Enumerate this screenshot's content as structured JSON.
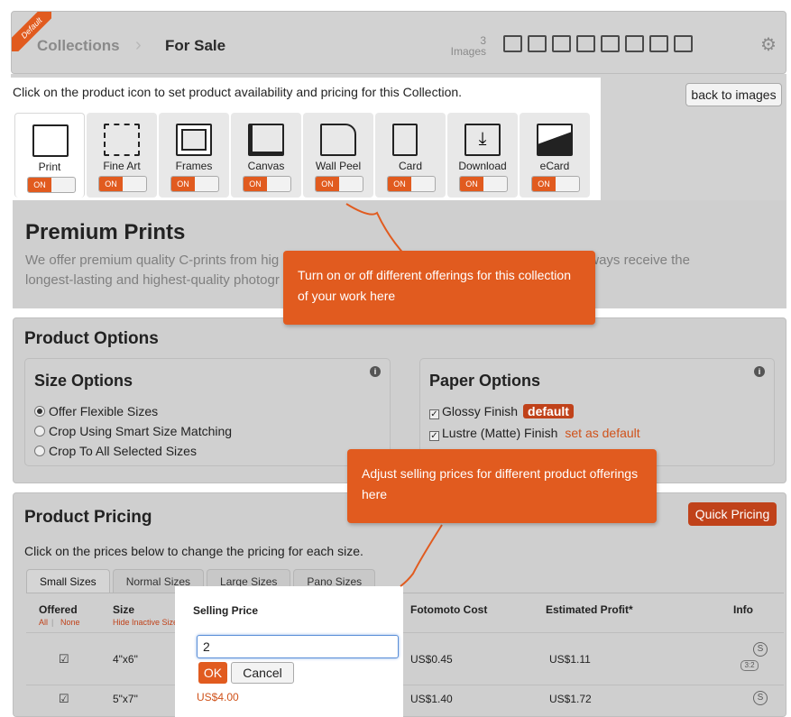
{
  "header": {
    "ribbon": "Default",
    "crumb_collections": "Collections",
    "crumb_separator": "›",
    "crumb_current": "For Sale",
    "image_count": "3",
    "image_count_label": "Images",
    "toolbar_icons": [
      "print-icon",
      "fine-art-icon",
      "frames-icon",
      "canvas-icon",
      "wall-peel-icon",
      "card-icon",
      "download-icon",
      "ecard-icon"
    ],
    "settings_icon": "gear-icon"
  },
  "products": {
    "intro": "Click on the product icon to set product availability and pricing for this Collection.",
    "back_button": "back to images",
    "items": [
      {
        "label": "Print",
        "toggle": "ON"
      },
      {
        "label": "Fine Art",
        "toggle": "ON"
      },
      {
        "label": "Frames",
        "toggle": "ON"
      },
      {
        "label": "Canvas",
        "toggle": "ON"
      },
      {
        "label": "Wall Peel",
        "toggle": "ON"
      },
      {
        "label": "Card",
        "toggle": "ON"
      },
      {
        "label": "Download",
        "toggle": "ON"
      },
      {
        "label": "eCard",
        "toggle": "ON"
      }
    ]
  },
  "premium": {
    "title": "Premium Prints",
    "line1_left": "We offer premium quality C-prints from hig",
    "line1_right": "you always receive the",
    "line2": "longest-lasting and highest-quality photogr"
  },
  "options": {
    "title": "Product Options",
    "size": {
      "title": "Size Options",
      "items": [
        "Offer Flexible Sizes",
        "Crop Using Smart Size Matching",
        "Crop To All Selected Sizes"
      ]
    },
    "paper": {
      "title": "Paper Options",
      "glossy": "Glossy Finish",
      "default_badge": "default",
      "lustre": "Lustre (Matte) Finish",
      "set_default": "set as default"
    }
  },
  "pricing": {
    "title": "Product Pricing",
    "quick_button": "Quick Pricing",
    "desc": "Click on the prices below to change the pricing for each size.",
    "tabs": [
      "Small Sizes",
      "Normal Sizes",
      "Large Sizes",
      "Pano Sizes"
    ],
    "columns": {
      "offered": "Offered",
      "all": "All",
      "none": "None",
      "size": "Size",
      "hide_inactive": "Hide Inactive Sizes",
      "selling": "Selling Price",
      "cost": "Fotomoto Cost",
      "profit": "Estimated Profit*",
      "info": "Info"
    },
    "rows": [
      {
        "size": "4\"x6\"",
        "price": "2",
        "cost": "US$0.45",
        "profit": "US$1.11",
        "info": "S",
        "ratio": "3:2"
      },
      {
        "size": "5\"x7\"",
        "price": "US$4.00",
        "cost": "US$1.40",
        "profit": "US$1.72",
        "info": "S"
      }
    ],
    "editor": {
      "ok": "OK",
      "cancel": "Cancel"
    }
  },
  "callouts": {
    "top": "Turn on or off different offerings for this collection of your work here",
    "bottom": "Adjust selling prices for different product offerings here"
  },
  "colors": {
    "accent": "#e15b1f",
    "dark_accent": "#c0421a",
    "overlay": "#cfcfcf"
  }
}
